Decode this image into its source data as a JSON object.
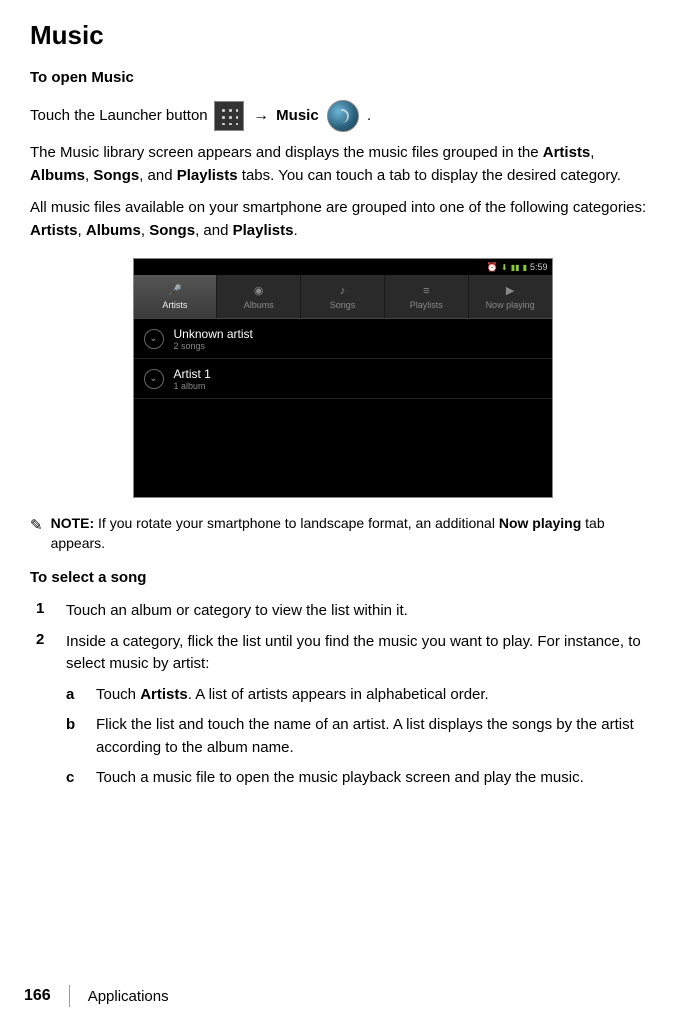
{
  "title": "Music",
  "section1_heading": "To open Music",
  "open_line": {
    "pre": "Touch the Launcher button ",
    "arrow": "→",
    "music_label": "Music",
    "period": "."
  },
  "para_library": {
    "t1": "The Music library screen appears and displays the music files grouped in the ",
    "artists": "Artists",
    "c1": ", ",
    "albums": "Albums",
    "c2": ", ",
    "songs": "Songs",
    "c3": ", and ",
    "playlists": "Playlists",
    "t2": " tabs. You can touch a tab to display the desired category."
  },
  "para_categories": {
    "t1": "All music files available on your smartphone are grouped into one of the following categories: ",
    "artists": "Artists",
    "c1": ", ",
    "albums": "Albums",
    "c2": ", ",
    "songs": "Songs",
    "c3": ", and ",
    "playlists": "Playlists",
    "t2": "."
  },
  "screenshot": {
    "status": {
      "alarm": "⏰",
      "dl": "⬇",
      "sig": "▮▮",
      "bat": "▮",
      "time": "5:59"
    },
    "tabs": {
      "artists": "Artists",
      "albums": "Albums",
      "songs": "Songs",
      "playlists": "Playlists",
      "now_playing": "Now playing"
    },
    "rows": [
      {
        "title": "Unknown artist",
        "sub": "2 songs"
      },
      {
        "title": "Artist 1",
        "sub": "1 album"
      }
    ]
  },
  "note": {
    "icon": "✎",
    "label": "NOTE:",
    "t1": " If you rotate your smartphone to landscape format, an additional ",
    "now_playing": "Now playing",
    "t2": " tab appears."
  },
  "section2_heading": "To select a song",
  "steps": {
    "s1": {
      "num": "1",
      "text": "Touch an album or category to view the list within it."
    },
    "s2": {
      "num": "2",
      "text": "Inside a category, flick the list until you find the music you want to play. For instance, to select music by artist:",
      "a": {
        "letter": "a",
        "pre": "Touch ",
        "artists": "Artists",
        "post": ". A list of artists appears in alphabetical order."
      },
      "b": {
        "letter": "b",
        "text": "Flick the list and touch the name of an artist. A list displays the songs by the artist according to the album name."
      },
      "c": {
        "letter": "c",
        "text": "Touch a music file to open the music playback screen and play the music."
      }
    }
  },
  "footer": {
    "page": "166",
    "section": "Applications"
  }
}
